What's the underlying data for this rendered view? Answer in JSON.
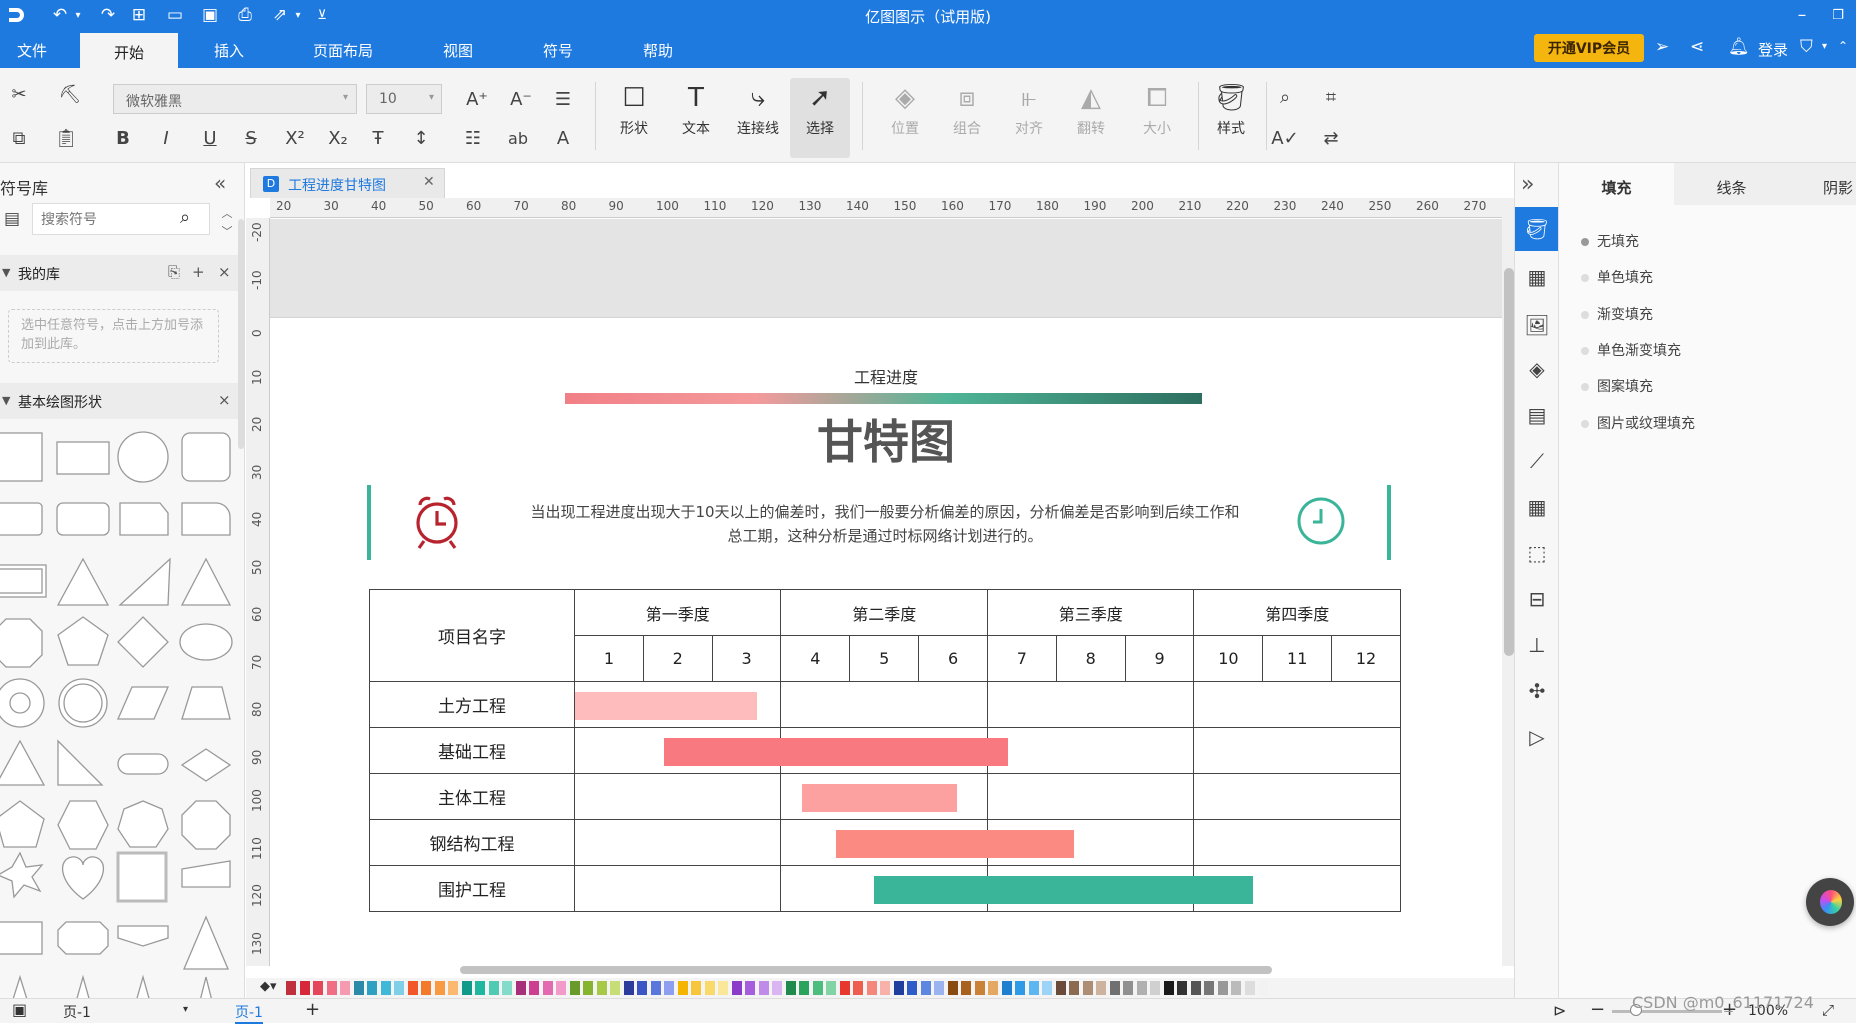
{
  "window": {
    "title": "亿图图示（试用版)"
  },
  "menu": {
    "tabs": [
      "文件",
      "开始",
      "插入",
      "页面布局",
      "视图",
      "符号",
      "帮助"
    ],
    "active_tab": "开始",
    "vip_label": "开通VIP会员",
    "login_label": "登录"
  },
  "ribbon": {
    "font_family": "微软雅黑",
    "font_size": "10",
    "shape_label": "形状",
    "text_label": "文本",
    "connector_label": "连接线",
    "select_label": "选择",
    "position_label": "位置",
    "group_label": "组合",
    "align_label": "对齐",
    "flip_label": "翻转",
    "size_label": "大小",
    "style_label": "样式"
  },
  "library": {
    "title": "符号库",
    "search_placeholder": "搜索符号",
    "my_library": "我的库",
    "my_library_hint": "选中任意符号，点击上方加号添加到此库。",
    "basic_shapes": "基本绘图形状"
  },
  "document": {
    "tab_name": "工程进度甘特图",
    "ruler_top": [
      "20",
      "30",
      "40",
      "50",
      "60",
      "70",
      "80",
      "90",
      "100",
      "110",
      "120",
      "130",
      "140",
      "150",
      "160",
      "170",
      "180",
      "190",
      "200",
      "210",
      "220",
      "230",
      "240",
      "250",
      "260",
      "270"
    ],
    "ruler_left": [
      "-20",
      "-10",
      "0",
      "10",
      "20",
      "30",
      "40",
      "50",
      "60",
      "70",
      "80",
      "90",
      "100",
      "110",
      "120",
      "130"
    ],
    "subtitle": "工程进度",
    "title": "甘特图",
    "description": "当出现工程进度出现大于10天以上的偏差时，我们一般要分析偏差的原因，分析偏差是否影响到后续工作和总工期，这种分析是通过时标网络计划进行的。",
    "gantt": {
      "name_header": "项目名字",
      "quarters": [
        "第一季度",
        "第二季度",
        "第三季度",
        "第四季度"
      ],
      "months": [
        "1",
        "2",
        "3",
        "4",
        "5",
        "6",
        "7",
        "8",
        "9",
        "10",
        "11",
        "12"
      ],
      "rows": [
        {
          "name": "土方工程",
          "start_month": 1.0,
          "end_month": 3.65,
          "color": "#ffbcbc"
        },
        {
          "name": "基础工程",
          "start_month": 2.3,
          "end_month": 7.3,
          "color": "#f8797f"
        },
        {
          "name": "主体工程",
          "start_month": 4.3,
          "end_month": 6.55,
          "color": "#fca0a0"
        },
        {
          "name": "钢结构工程",
          "start_month": 4.8,
          "end_month": 8.25,
          "color": "#fb8a82"
        },
        {
          "name": "围护工程",
          "start_month": 5.35,
          "end_month": 10.85,
          "color": "#3bb59a"
        }
      ]
    }
  },
  "properties": {
    "tabs": [
      "填充",
      "线条",
      "阴影"
    ],
    "fill_options": [
      "无填充",
      "单色填充",
      "渐变填充",
      "单色渐变填充",
      "图案填充",
      "图片或纹理填充"
    ],
    "selected_fill": "无填充"
  },
  "status": {
    "page_select": "页-1",
    "active_page": "页-1",
    "zoom": "100%"
  },
  "watermark": "CSDN @m0_61171724",
  "palette": [
    "#c0303c",
    "#d6283a",
    "#e4465a",
    "#f06d86",
    "#f59ab0",
    "#2b8aa8",
    "#2ea1c2",
    "#40b8d6",
    "#7fd0e6",
    "#f2562b",
    "#f47a2b",
    "#f79a42",
    "#fbb86f",
    "#0f9a8a",
    "#1fb79f",
    "#4fcab3",
    "#85dbc9",
    "#a8307a",
    "#cc3f91",
    "#e36ab0",
    "#f29bcb",
    "#6a9a2a",
    "#86b430",
    "#a6c948",
    "#c7dd76",
    "#2d3c9c",
    "#3d55c4",
    "#5b77dc",
    "#8e9ef0",
    "#f4b400",
    "#f7c63a",
    "#f9d967",
    "#fbe79a",
    "#8a3cc8",
    "#a55fdc",
    "#c08ae8",
    "#d9b6f2",
    "#1f8a4e",
    "#2aa35f",
    "#4dbd7d",
    "#82d4a4",
    "#e8382e",
    "#ef5d4f",
    "#f4877a",
    "#f8b2a9",
    "#1f3e9e",
    "#2f5cc8",
    "#5c86e0",
    "#9bb4f0",
    "#8a4b13",
    "#a8621e",
    "#c98236",
    "#e4a862",
    "#1c7fd0",
    "#2f9ae6",
    "#5cb6f0",
    "#9dd3f7",
    "#6a4a3a",
    "#8c6a52",
    "#ad8d74",
    "#cdb39d",
    "#707070",
    "#909090",
    "#b0b0b0",
    "#d0d0d0",
    "#1a1a1a",
    "#333333",
    "#555555",
    "#777777",
    "#999999",
    "#bbbbbb",
    "#dddddd",
    "#f2f2f2"
  ]
}
